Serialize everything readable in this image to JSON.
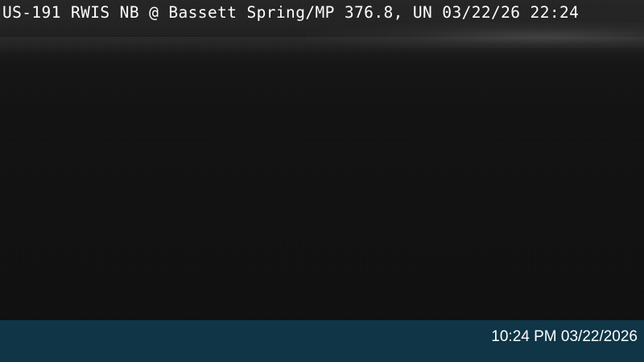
{
  "camera": {
    "overlay_text": "US-191 RWIS NB @ Bassett Spring/MP 376.8, UN 03/22/26 22:24"
  },
  "info_bar": {
    "timestamp": "10:24 PM 03/22/2026",
    "background_color": "#0f3547"
  }
}
